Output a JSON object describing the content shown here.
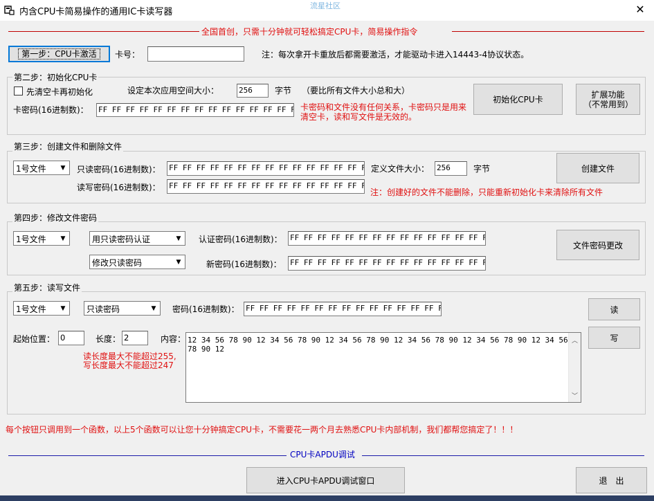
{
  "window": {
    "title": "内含CPU卡简易操作的通用IC卡读写器",
    "watermark": "流星社区",
    "close_glyph": "✕"
  },
  "banner": {
    "text": "全国首创，只需十分钟就可轻松搞定CPU卡，简易操作指令"
  },
  "step1": {
    "button_label": "第一步：CPU卡激活",
    "card_no_label": "卡号：",
    "card_no_value": "",
    "note": "注：每次拿开卡重放后都需要激活，才能驱动卡进入14443-4协议状态。"
  },
  "step2": {
    "group_label": "第二步：初始化CPU卡",
    "clear_checkbox_label": "先清空卡再初始化",
    "space_label": "设定本次应用空间大小：",
    "space_value": "256",
    "space_unit": "字节",
    "space_hint": "（要比所有文件大小总和大）",
    "card_pwd_label": "卡密码(16进制数)：",
    "card_pwd_value": "FF FF FF FF FF FF FF FF FF FF FF FF FF FF FF FF",
    "note": "卡密码和文件没有任何关系，卡密码只是用来清空卡，读和写文件是无效的。",
    "init_button": "初始化CPU卡",
    "ext_button": "扩展功能（不常用到）"
  },
  "step3": {
    "group_label": "第三步：创建文件和删除文件",
    "file_select": "1号文件",
    "ro_pwd_label": "只读密码(16进制数)：",
    "ro_pwd_value": "FF FF FF FF FF FF FF FF FF FF FF FF FF FF FF FF",
    "rw_pwd_label": "读写密码(16进制数)：",
    "rw_pwd_value": "FF FF FF FF FF FF FF FF FF FF FF FF FF FF FF FF",
    "size_label": "定义文件大小：",
    "size_value": "256",
    "size_unit": "字节",
    "create_button": "创建文件",
    "note": "注：创建好的文件不能删除，只能重新初始化卡来清除所有文件"
  },
  "step4": {
    "group_label": "第四步：修改文件密码",
    "file_select": "1号文件",
    "auth_select": "用只读密码认证",
    "modify_select": "修改只读密码",
    "auth_pwd_label": "认证密码(16进制数)：",
    "auth_pwd_value": "FF FF FF FF FF FF FF FF FF FF FF FF FF FF FF FF",
    "new_pwd_label": "新密码(16进制数)：",
    "new_pwd_value": "FF FF FF FF FF FF FF FF FF FF FF FF FF FF FF FF",
    "change_button": "文件密码更改"
  },
  "step5": {
    "group_label": "第五步：读写文件",
    "file_select": "1号文件",
    "pwd_type_select": "只读密码",
    "pwd_label": "密码(16进制数)：",
    "pwd_value": "FF FF FF FF FF FF FF FF FF FF FF FF FF FF FF FF",
    "read_button": "读",
    "write_button": "写",
    "start_label": "起始位置：",
    "start_value": "0",
    "len_label": "长度：",
    "len_value": "2",
    "content_label": "内容：",
    "content_value": "12 34 56 78 90 12 34 56 78 90 12 34 56 78 90 12 34 56 78 90 12 34 56 78 90 12 34 56 78 90 12",
    "limit_read": "读长度最大不能超过255,",
    "limit_write": "写长度最大不能超过247"
  },
  "footer": {
    "summary": "每个按钮只调用到一个函数，以上5个函数可以让您十分钟搞定CPU卡，不需要花一两个月去熟悉CPU卡内部机制，我们都帮您搞定了！！！",
    "apdu_section": "CPU卡APDU调试",
    "apdu_button": "进入CPU卡APDU调试窗口",
    "exit_button": "退　出"
  },
  "colors": {
    "red_text": "#e01010",
    "blue_text": "#0000c0",
    "focus_border": "#0078d7"
  }
}
